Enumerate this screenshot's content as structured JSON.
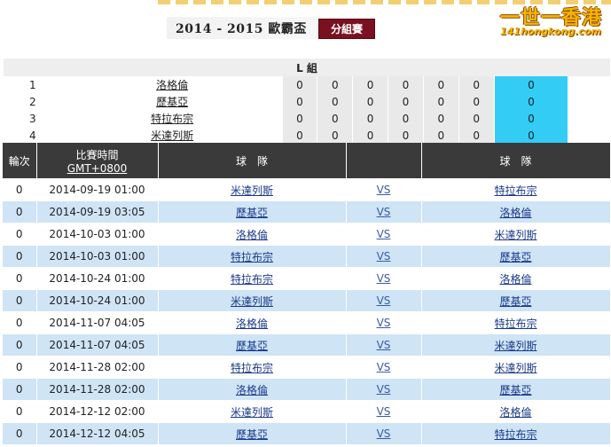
{
  "header": {
    "title": "2014 - 2015 歐霸盃",
    "stage_button": "分組賽",
    "logo_main": "一世一香港",
    "logo_sub": "141hongkong.com"
  },
  "group": {
    "name": "L 組",
    "standings": [
      {
        "rank": "1",
        "team": "洛格倫",
        "stats": [
          "0",
          "0",
          "0",
          "0",
          "0",
          "0"
        ],
        "points": "0"
      },
      {
        "rank": "2",
        "team": "歷基亞",
        "stats": [
          "0",
          "0",
          "0",
          "0",
          "0",
          "0"
        ],
        "points": "0"
      },
      {
        "rank": "3",
        "team": "特拉布宗",
        "stats": [
          "0",
          "0",
          "0",
          "0",
          "0",
          "0"
        ],
        "points": "0"
      },
      {
        "rank": "4",
        "team": "米達列斯",
        "stats": [
          "0",
          "0",
          "0",
          "0",
          "0",
          "0"
        ],
        "points": "0"
      }
    ]
  },
  "matches": {
    "headers": {
      "round": "輪次",
      "time_line1": "比賽時間",
      "time_line2": "GMT+0800",
      "home": "球　隊",
      "away": "球　隊"
    },
    "rows": [
      {
        "round": "0",
        "time": "2014-09-19 01:00",
        "home": "米達列斯",
        "vs": "VS",
        "away": "特拉布宗"
      },
      {
        "round": "0",
        "time": "2014-09-19 03:05",
        "home": "歷基亞",
        "vs": "VS",
        "away": "洛格倫"
      },
      {
        "round": "0",
        "time": "2014-10-03 01:00",
        "home": "洛格倫",
        "vs": "VS",
        "away": "米達列斯"
      },
      {
        "round": "0",
        "time": "2014-10-03 01:00",
        "home": "特拉布宗",
        "vs": "VS",
        "away": "歷基亞"
      },
      {
        "round": "0",
        "time": "2014-10-24 01:00",
        "home": "特拉布宗",
        "vs": "VS",
        "away": "洛格倫"
      },
      {
        "round": "0",
        "time": "2014-10-24 01:00",
        "home": "米達列斯",
        "vs": "VS",
        "away": "歷基亞"
      },
      {
        "round": "0",
        "time": "2014-11-07 04:05",
        "home": "洛格倫",
        "vs": "VS",
        "away": "特拉布宗"
      },
      {
        "round": "0",
        "time": "2014-11-07 04:05",
        "home": "歷基亞",
        "vs": "VS",
        "away": "米達列斯"
      },
      {
        "round": "0",
        "time": "2014-11-28 02:00",
        "home": "特拉布宗",
        "vs": "VS",
        "away": "米達列斯"
      },
      {
        "round": "0",
        "time": "2014-11-28 02:00",
        "home": "洛格倫",
        "vs": "VS",
        "away": "歷基亞"
      },
      {
        "round": "0",
        "time": "2014-12-12 02:00",
        "home": "米達列斯",
        "vs": "VS",
        "away": "洛格倫"
      },
      {
        "round": "0",
        "time": "2014-12-12 04:05",
        "home": "歷基亞",
        "vs": "VS",
        "away": "特拉布宗"
      }
    ]
  }
}
